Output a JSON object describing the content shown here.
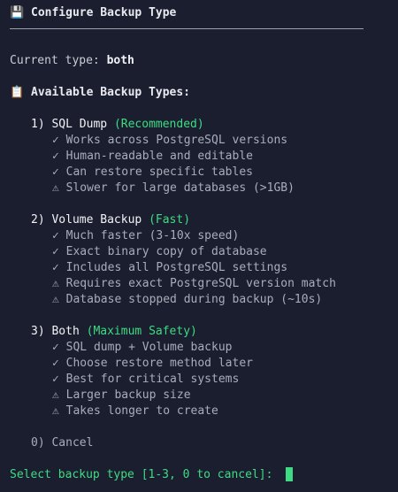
{
  "header": {
    "icon": "floppy-disk-icon",
    "icon_glyph": "💾",
    "title": "Configure Backup Type"
  },
  "current": {
    "label": "Current type: ",
    "value": "both"
  },
  "available": {
    "icon": "clipboard-icon",
    "icon_glyph": "📋",
    "heading": "Available Backup Types:"
  },
  "options": [
    {
      "number": "1)",
      "name": "SQL Dump",
      "tag": "(Recommended)",
      "features": [
        "✓ Works across PostgreSQL versions",
        "✓ Human-readable and editable",
        "✓ Can restore specific tables",
        "⚠ Slower for large databases (>1GB)"
      ]
    },
    {
      "number": "2)",
      "name": "Volume Backup",
      "tag": "(Fast)",
      "features": [
        "✓ Much faster (3-10x speed)",
        "✓ Exact binary copy of database",
        "✓ Includes all PostgreSQL settings",
        "⚠ Requires exact PostgreSQL version match",
        "⚠ Database stopped during backup (~10s)"
      ]
    },
    {
      "number": "3)",
      "name": "Both",
      "tag": "(Maximum Safety)",
      "features": [
        "✓ SQL dump + Volume backup",
        "✓ Choose restore method later",
        "✓ Best for critical systems",
        "⚠ Larger backup size",
        "⚠ Takes longer to create"
      ]
    }
  ],
  "cancel_option": "0) Cancel",
  "prompt": "Select backup type [1-3, 0 to cancel]: ",
  "colors": {
    "background": "#1b1e2e",
    "accent_green": "#3ddc84",
    "text": "#c9cdd8"
  }
}
